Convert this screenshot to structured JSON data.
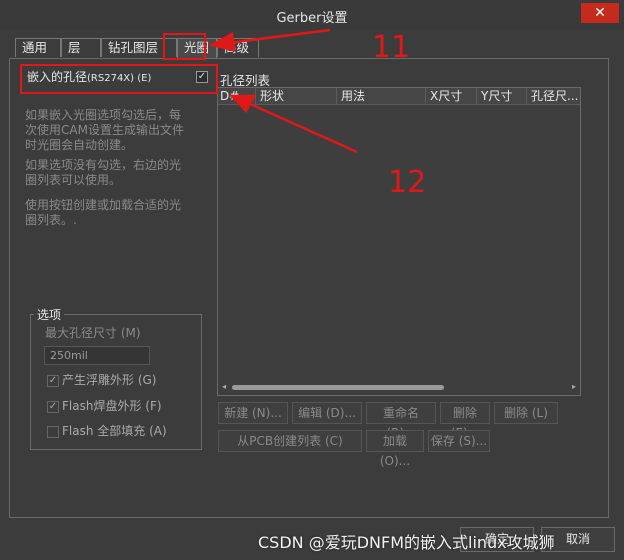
{
  "window": {
    "title": "Gerber设置",
    "close_glyph": "✕"
  },
  "tabs": [
    {
      "label": "通用"
    },
    {
      "label": "层"
    },
    {
      "label": "钻孔图层"
    },
    {
      "label": "光圈",
      "active": true
    },
    {
      "label": "高级"
    }
  ],
  "embed": {
    "label": "嵌入的孔径",
    "label_small": "(RS274X) (E)",
    "checked": true,
    "check_glyph": "✓"
  },
  "info": {
    "p1_line1": "如果嵌入光圈选项勾选后，每",
    "p1_line2": "次使用CAM设置生成输出文件",
    "p1_line3": "时光圈会自动创建。",
    "p2_line1": "如果选项没有勾选，右边的光",
    "p2_line2": "圈列表可以使用。",
    "p3_line1": "使用按钮创建或加载合适的光",
    "p3_line2": "圈列表。."
  },
  "options": {
    "title": "选项",
    "max_size_label": "最大孔径尺寸 (M)",
    "max_size_value": "250mil",
    "generate_relief": "产生浮雕外形 (G)",
    "flash_pad": "Flash焊盘外形 (F)",
    "flash_fill": "Flash 全部填充 (A)",
    "check_glyph": "✓"
  },
  "aperture_list": {
    "title": "孔径列表",
    "columns": [
      "D#",
      "形状",
      "用法",
      "X尺寸",
      "Y尺寸",
      "孔径尺..."
    ]
  },
  "scroll": {
    "left_arrow": "◂",
    "right_arrow": "▸"
  },
  "buttons": {
    "new": "新建 (N)...",
    "edit": "编辑 (D)...",
    "rename": "重命名 (R)...",
    "delete_ellipsis": "删除 (E)...",
    "delete": "删除 (L)",
    "from_pcb": "从PCB创建列表 (C)",
    "load": "加载 (O)...",
    "save": "保存 (S)..."
  },
  "footer": {
    "ok": "确定",
    "cancel": "取消"
  },
  "watermark": "CSDN @爱玩DNFM的嵌入式linux攻城狮",
  "annotations": {
    "n11": "11",
    "n12": "12"
  },
  "colors": {
    "annotation_red": "#e01818",
    "close_red": "#c42b1c",
    "background": "#3c3c3c"
  }
}
